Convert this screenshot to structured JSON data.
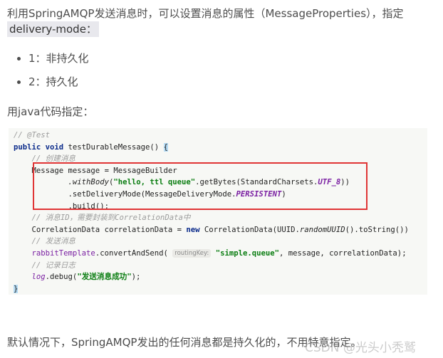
{
  "intro": {
    "text": "利用SpringAMQP发送消息时，可以设置消息的属性（MessageProperties），指定",
    "code": "delivery-mode："
  },
  "bullets": [
    "1：非持久化",
    "2：持久化"
  ],
  "java_label": "用java代码指定：",
  "code": {
    "l1": "// @Test",
    "l2_kw": "public void",
    "l2_rest": " testDurableMessage() ",
    "l2_brace": "{",
    "l3": "// 创建消息",
    "l4": "Message message = MessageBuilder",
    "l5_method": ".withBody",
    "l5_open": "(",
    "l5_str": "\"hello, ttl queue\"",
    "l5_mid": ".getBytes(StandardCharsets.",
    "l5_const": "UTF_8",
    "l5_end": "))",
    "l6_pre": ".setDeliveryMode(MessageDeliveryMode.",
    "l6_const": "PERSISTENT",
    "l6_end": ")",
    "l7": ".build();",
    "l8": "// 消息ID，需要封装到CorrelationData中",
    "l9_pre": "CorrelationData correlationData = ",
    "l9_kw": "new",
    "l9_mid": " CorrelationData(UUID.",
    "l9_method": "randomUUID",
    "l9_end": "().toString())",
    "l10": "// 发送消息",
    "l11_field": "rabbitTemplate",
    "l11_pre": ".convertAndSend(",
    "l11_hint": "routingKey:",
    "l11_str": "\"simple.queue\"",
    "l11_end": ", message, correlationData);",
    "l12": "// 记录日志",
    "l13_field": "log",
    "l13_pre": ".debug(",
    "l13_str": "\"发送消息成功\"",
    "l13_end": ");",
    "l14": "}"
  },
  "bottom_text": "默认情况下，SpringAMQP发出的任何消息都是持久化的，不用特意指定。",
  "watermark": "CSDN @光头小秃鹫"
}
